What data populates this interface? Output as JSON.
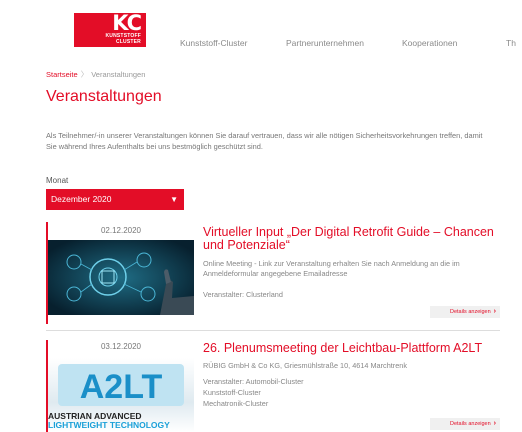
{
  "header": {
    "logo_main": "KC",
    "logo_sub1": "KUNSTSTOFF",
    "logo_sub2": "CLUSTER",
    "nav": [
      "Kunststoff-Cluster",
      "Partnerunternehmen",
      "Kooperationen",
      "Th"
    ]
  },
  "breadcrumb": {
    "home": "Startseite",
    "separator": "〉",
    "current": "Veranstaltungen"
  },
  "page": {
    "title": "Veranstaltungen",
    "intro": "Als Teilnehmer/-in unserer Veranstaltungen können Sie darauf vertrauen, dass wir alle nötigen Sicherheitsvorkehrungen treffen, damit Sie während Ihres Aufenthalts bei uns bestmöglich geschützt sind."
  },
  "filter": {
    "label": "Monat",
    "selected": "Dezember 2020"
  },
  "events": [
    {
      "date": "02.12.2020",
      "title": "Virtueller Input „Der Digital Retrofit Guide – Chancen und Potenziale“",
      "description": "Online Meeting - Link zur Veranstaltung erhalten Sie nach Anmeldung an die im Anmeldeformular angegebene Emailadresse",
      "organizers": [
        "Veranstalter: Clusterland"
      ],
      "details_label": "Details anzeigen"
    },
    {
      "date": "03.12.2020",
      "title": "26. Plenumsmeeting der Leichtbau-Plattform A2LT",
      "description": "RÜBIG GmbH & Co KG, Griesmühlstraße 10, 4614 Marchtrenk",
      "organizers": [
        "Veranstalter: Automobil-Cluster",
        "Kunststoff-Cluster",
        "Mechatronik-Cluster"
      ],
      "details_label": "Details anzeigen",
      "image_text": [
        "A2LT",
        "AUSTRIAN ADVANCED",
        "LIGHTWEIGHT TECHNOLOGY"
      ]
    }
  ],
  "colors": {
    "accent": "#e30d27",
    "text": "#555555",
    "muted": "#888888"
  }
}
